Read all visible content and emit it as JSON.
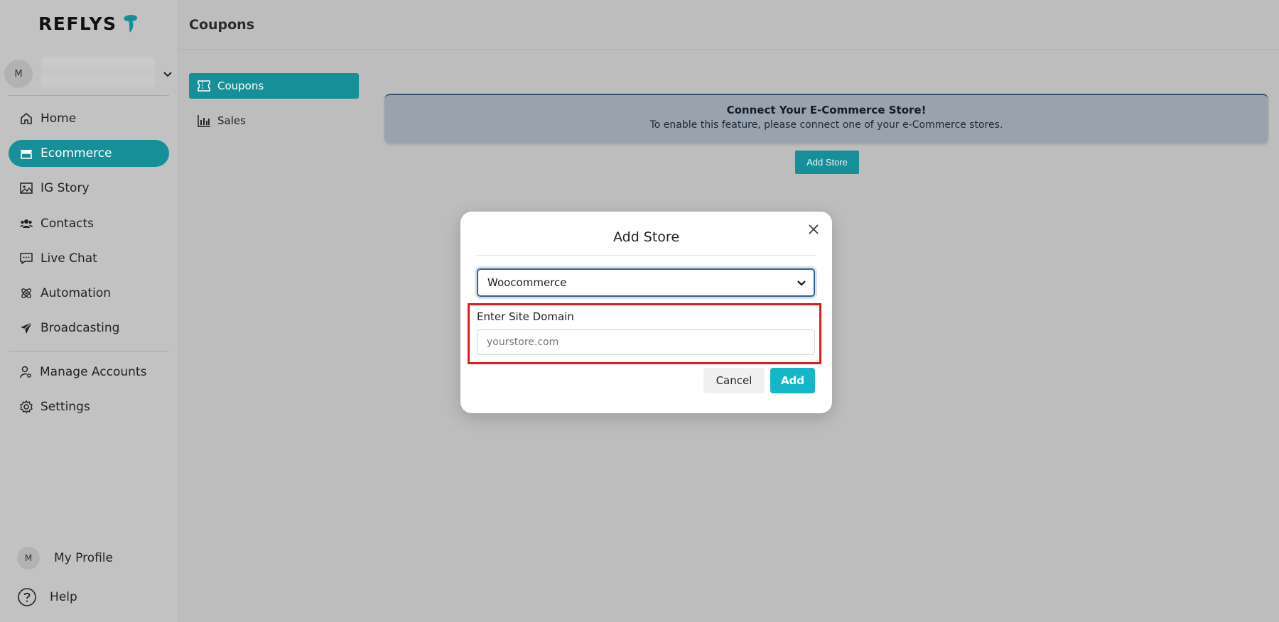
{
  "app": {
    "brand": "REFLYS",
    "accent_color": "#178f99"
  },
  "account": {
    "avatar_initial": "M"
  },
  "sidebar": {
    "items": [
      {
        "label": "Home",
        "icon": "home-icon"
      },
      {
        "label": "Ecommerce",
        "icon": "store-icon",
        "active": true
      },
      {
        "label": "IG Story",
        "icon": "image-icon"
      },
      {
        "label": "Contacts",
        "icon": "users-icon"
      },
      {
        "label": "Live Chat",
        "icon": "chat-icon"
      },
      {
        "label": "Automation",
        "icon": "atom-icon"
      },
      {
        "label": "Broadcasting",
        "icon": "send-icon"
      }
    ],
    "secondary": [
      {
        "label": "Manage Accounts",
        "icon": "user-cog-icon"
      },
      {
        "label": "Settings",
        "icon": "gear-icon"
      }
    ],
    "profile": {
      "initial": "M",
      "label": "My Profile"
    },
    "help": {
      "label": "Help"
    }
  },
  "header": {
    "title": "Coupons"
  },
  "submenu": [
    {
      "label": "Coupons",
      "icon": "ticket-icon",
      "active": true
    },
    {
      "label": "Sales",
      "icon": "bar-chart-icon"
    }
  ],
  "banner": {
    "title": "Connect Your E-Commerce Store!",
    "subtitle": "To enable this feature, please connect one of your e-Commerce stores.",
    "button": "Add Store"
  },
  "modal": {
    "title": "Add Store",
    "platform_selected": "Woocommerce",
    "domain_label": "Enter Site Domain",
    "domain_placeholder": "yourstore.com",
    "cancel": "Cancel",
    "add": "Add"
  }
}
